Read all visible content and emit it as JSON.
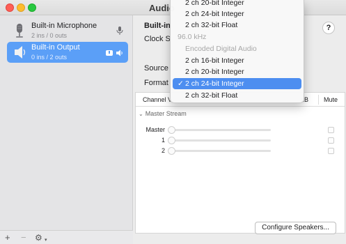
{
  "window": {
    "title": "Audio"
  },
  "sidebar": {
    "devices": [
      {
        "name": "Built-in Microphone",
        "detail": "2 ins / 0 outs"
      },
      {
        "name": "Built-in Output",
        "detail": "0 ins / 2 outs"
      }
    ],
    "footer": {
      "add": "+",
      "remove": "−",
      "gear": "⚙",
      "chevron": "▾"
    }
  },
  "pane": {
    "device_title": "Built-in",
    "help": "?",
    "clock_label": "Clock S",
    "source_label": "Source",
    "format_label": "Format"
  },
  "table": {
    "headers": {
      "channel": "Channel V",
      "db": "dB",
      "mute": "Mute"
    },
    "stream": "Master Stream",
    "rows": [
      {
        "label": "Master"
      },
      {
        "label": "1"
      },
      {
        "label": "2"
      }
    ]
  },
  "configure_button": "Configure Speakers...",
  "format_menu": {
    "items": [
      {
        "label": "2 ch 20-bit Integer",
        "state": "normal"
      },
      {
        "label": "2 ch 24-bit Integer",
        "state": "normal"
      },
      {
        "label": "2 ch 32-bit Float",
        "state": "normal"
      },
      {
        "label": "96.0 kHz",
        "state": "header"
      },
      {
        "label": "Encoded Digital Audio",
        "state": "disabled"
      },
      {
        "label": "2 ch 16-bit Integer",
        "state": "normal"
      },
      {
        "label": "2 ch 20-bit Integer",
        "state": "normal"
      },
      {
        "label": "2 ch 24-bit Integer",
        "state": "selected"
      },
      {
        "label": "2 ch 32-bit Float",
        "state": "normal"
      }
    ],
    "checkmark": "✓"
  },
  "colors": {
    "accent": "#4d8ef0",
    "selection": "#5b9ff7"
  }
}
